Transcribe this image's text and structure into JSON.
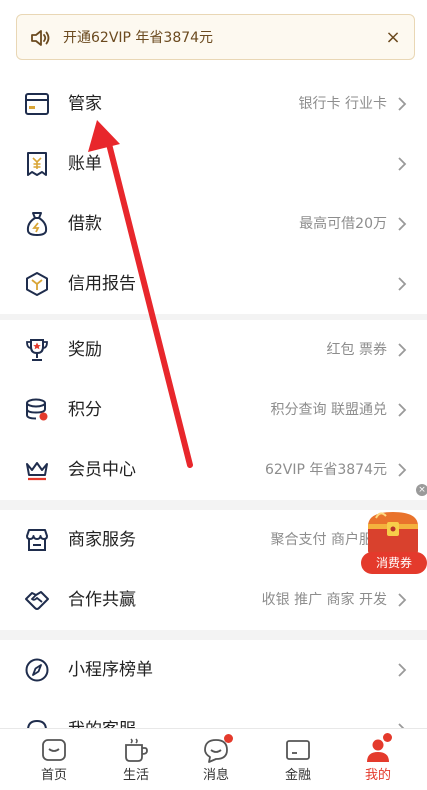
{
  "banner": {
    "text": "开通62VIP 年省3874元",
    "close": "×"
  },
  "groups": [
    [
      {
        "name": "管家",
        "desc": "银行卡 行业卡",
        "icon": "card-icon"
      },
      {
        "name": "账单",
        "desc": "",
        "icon": "bill-icon"
      },
      {
        "name": "借款",
        "desc": "最高可借20万",
        "icon": "loan-bag-icon"
      },
      {
        "name": "信用报告",
        "desc": "",
        "icon": "credit-report-icon"
      }
    ],
    [
      {
        "name": "奖励",
        "desc": "红包 票券",
        "icon": "trophy-icon"
      },
      {
        "name": "积分",
        "desc": "积分查询 联盟通兑",
        "icon": "coin-stack-icon"
      },
      {
        "name": "会员中心",
        "desc": "62VIP 年省3874元",
        "icon": "crown-icon"
      }
    ],
    [
      {
        "name": "商家服务",
        "desc": "聚合支付 商户服务",
        "icon": "store-icon"
      },
      {
        "name": "合作共赢",
        "desc": "收银 推广 商家 开发",
        "icon": "handshake-icon"
      }
    ],
    [
      {
        "name": "小程序榜单",
        "desc": "",
        "icon": "compass-icon"
      },
      {
        "name": "我的客服",
        "desc": "",
        "icon": "headset-icon"
      }
    ]
  ],
  "float_ad": {
    "label": "消费券",
    "close": "×"
  },
  "tabbar": [
    {
      "label": "首页",
      "icon": "home-icon",
      "active": false,
      "badge": false
    },
    {
      "label": "生活",
      "icon": "cup-icon",
      "active": false,
      "badge": false
    },
    {
      "label": "消息",
      "icon": "message-icon",
      "active": false,
      "badge": true
    },
    {
      "label": "金融",
      "icon": "finance-icon",
      "active": false,
      "badge": false
    },
    {
      "label": "我的",
      "icon": "profile-icon",
      "active": true,
      "badge": true
    }
  ],
  "colors": {
    "accent": "#e43a2c",
    "icon_navy": "#1f2d4d",
    "gold": "#d9a536",
    "banner_text": "#6b4a1f"
  }
}
